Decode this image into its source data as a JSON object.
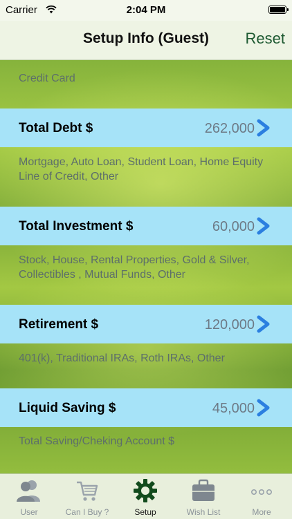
{
  "status_bar": {
    "carrier": "Carrier",
    "time": "2:04 PM"
  },
  "nav": {
    "title": "Setup Info (Guest)",
    "reset_label": "Reset"
  },
  "top_desc": "Credit Card",
  "rows": [
    {
      "label": "Total Debt $",
      "value": "262,000",
      "description": "Mortgage, Auto Loan, Student Loan, Home Equity Line of Credit, Other"
    },
    {
      "label": "Total Investment $",
      "value": "60,000",
      "description": "Stock, House, Rental Properties, Gold & Silver, Collectibles , Mutual Funds, Other"
    },
    {
      "label": "Retirement $",
      "value": "120,000",
      "description": "401(k), Traditional IRAs, Roth IRAs, Other"
    },
    {
      "label": "Liquid Saving $",
      "value": "45,000",
      "description": "Total Saving/Cheking Account $"
    }
  ],
  "tabs": [
    {
      "label": "User",
      "icon": "user-icon"
    },
    {
      "label": "Can I Buy ?",
      "icon": "cart-icon"
    },
    {
      "label": "Setup",
      "icon": "gear-icon",
      "active": true
    },
    {
      "label": "Wish List",
      "icon": "briefcase-icon"
    },
    {
      "label": "More",
      "icon": "more-icon"
    }
  ],
  "colors": {
    "band": "#a6e3f8",
    "accent_green": "#1e5a32",
    "chevron_blue": "#2b7fe0"
  }
}
